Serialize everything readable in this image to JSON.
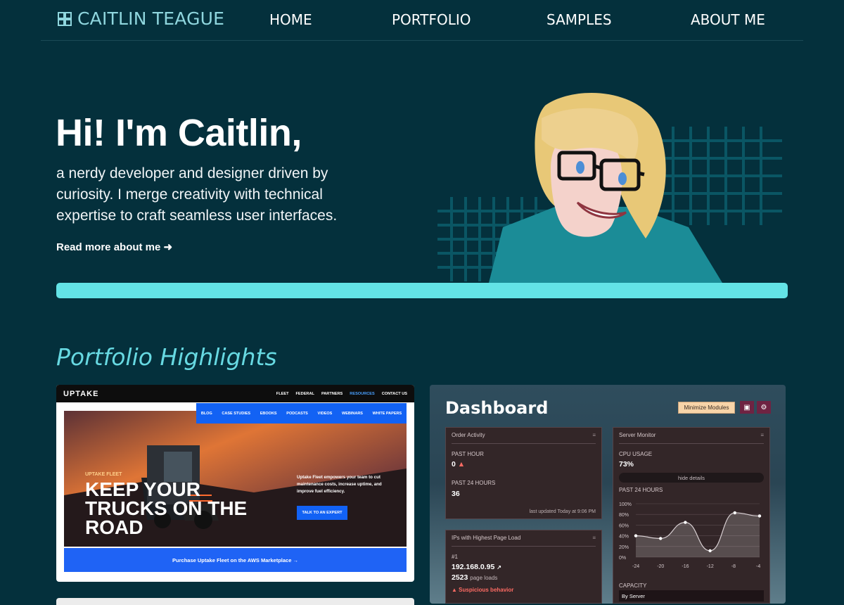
{
  "header": {
    "logo_text": "CAITLIN TEAGUE",
    "nav": [
      "HOME",
      "PORTFOLIO",
      "SAMPLES",
      "ABOUT ME"
    ]
  },
  "hero": {
    "title": "Hi! I'm Caitlin,",
    "subtitle": "a nerdy developer and designer driven by curiosity. I merge creativity with technical expertise to craft seamless user interfaces.",
    "read_more": "Read more about me ➜"
  },
  "portfolio": {
    "title": "Portfolio Highlights",
    "uptake": {
      "logo": "UPTAKE",
      "menu": [
        "FLEET",
        "FEDERAL",
        "PARTNERS",
        "RESOURCES",
        "CONTACT US"
      ],
      "submenu": [
        "BLOG",
        "CASE STUDIES",
        "EBOOKS",
        "PODCASTS",
        "VIDEOS",
        "WEBINARS",
        "WHITE PAPERS"
      ],
      "kicker": "UPTAKE FLEET",
      "headline": "KEEP YOUR TRUCKS ON THE ROAD",
      "promo": "Uptake Fleet empowers your team to cut maintenance costs, increase uptime, and improve fuel efficiency.",
      "cta": "TALK TO AN EXPERT",
      "bottom_cta": "Purchase Uptake Fleet on the AWS Marketplace →"
    },
    "dashboard": {
      "title": "Dashboard",
      "minimize_button": "Minimize Modules",
      "order_activity": {
        "title": "Order Activity",
        "past_hour_label": "PAST HOUR",
        "past_hour_value": "0",
        "past_24_label": "PAST 24 HOURS",
        "past_24_value": "36",
        "updated": "last updated Today at 9:06 PM"
      },
      "server_monitor": {
        "title": "Server Monitor",
        "cpu_label": "CPU USAGE",
        "cpu_value": "73%",
        "hide_details": "hide details",
        "past_24_label": "PAST 24 HOURS",
        "capacity_label": "CAPACITY",
        "by_server": "By Server"
      },
      "ip_panel": {
        "title": "IPs with Highest Page Load",
        "rank": "#1",
        "ip": "192.168.0.95",
        "loads": "2523",
        "loads_label": "page loads",
        "warning": "Suspicious behavior"
      }
    }
  },
  "chart_data": {
    "type": "line",
    "x": [
      -24,
      -20,
      -16,
      -12,
      -8,
      -4
    ],
    "series": [
      {
        "values": [
          40,
          35,
          65,
          12,
          83,
          77
        ]
      }
    ],
    "ylim": [
      0,
      100
    ],
    "yticks": [
      "100%",
      "80%",
      "60%",
      "40%",
      "20%",
      "0%"
    ],
    "xticks": [
      "-24",
      "-20",
      "-16",
      "-12",
      "-8",
      "-4"
    ]
  },
  "colors": {
    "background": "#04303c",
    "accent": "#63e3e6",
    "portfolio_title": "#67d9e2",
    "uptake_blue": "#1262f4"
  }
}
